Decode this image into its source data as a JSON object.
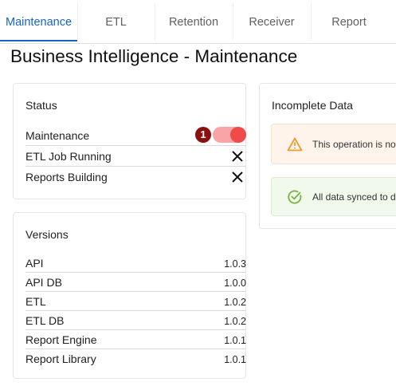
{
  "tabs": [
    {
      "label": "Maintenance",
      "active": true
    },
    {
      "label": "ETL",
      "active": false
    },
    {
      "label": "Retention",
      "active": false
    },
    {
      "label": "Receiver",
      "active": false
    },
    {
      "label": "Report",
      "active": false
    }
  ],
  "page_title": "Business Intelligence - Maintenance",
  "status_card": {
    "title": "Status",
    "rows": [
      {
        "label": "Maintenance",
        "control": "toggle",
        "toggle_on": true,
        "badge": "1"
      },
      {
        "label": "ETL Job Running",
        "control": "close-icon"
      },
      {
        "label": "Reports Building",
        "control": "close-icon"
      }
    ]
  },
  "versions_card": {
    "title": "Versions",
    "rows": [
      {
        "label": "API",
        "value": "1.0.3"
      },
      {
        "label": "API DB",
        "value": "1.0.0"
      },
      {
        "label": "ETL",
        "value": "1.0.2"
      },
      {
        "label": "ETL DB",
        "value": "1.0.2"
      },
      {
        "label": "Report Engine",
        "value": "1.0.1"
      },
      {
        "label": "Report Library",
        "value": "1.0.1"
      }
    ]
  },
  "incomplete_card": {
    "title": "Incomplete Data",
    "alerts": [
      {
        "type": "warning",
        "icon": "warning-icon",
        "text": "This operation is not",
        "bg": "#fff4ec",
        "border": "#f6e0cf",
        "icon_color": "#ef9a2f"
      },
      {
        "type": "success",
        "icon": "check-circle-icon",
        "text": "All data synced to da",
        "bg": "#f1f8ec",
        "border": "#dcebd0",
        "icon_color": "#7cb342"
      }
    ]
  },
  "colors": {
    "accent": "#1565c0",
    "toggle_track": "#f8a5a5",
    "toggle_knob": "#f04a4a",
    "badge": "#8b0f0f"
  }
}
